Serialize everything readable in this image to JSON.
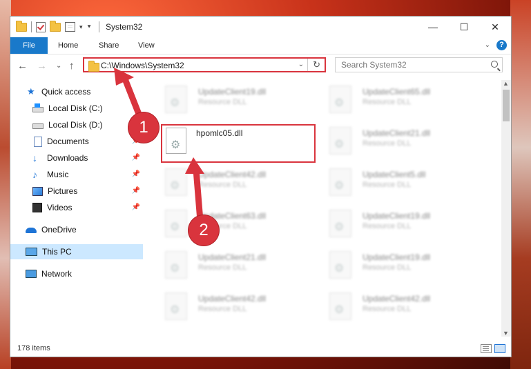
{
  "window": {
    "title": "System32",
    "controls": [
      "—",
      "☐",
      "✕"
    ]
  },
  "ribbon": {
    "tabs": [
      "File",
      "Home",
      "Share",
      "View"
    ]
  },
  "address": {
    "path": "C:\\Windows\\System32"
  },
  "search": {
    "placeholder": "Search System32"
  },
  "sidebar": {
    "items": [
      {
        "label": "Quick access",
        "icon": "star-icon"
      },
      {
        "label": "Local Disk (C:)",
        "icon": "windows-drive-icon"
      },
      {
        "label": "Local Disk (D:)",
        "icon": "drive-icon"
      },
      {
        "label": "Documents",
        "icon": "documents-icon",
        "pinned": true
      },
      {
        "label": "Downloads",
        "icon": "downloads-icon",
        "pinned": true
      },
      {
        "label": "Music",
        "icon": "music-icon",
        "pinned": true
      },
      {
        "label": "Pictures",
        "icon": "pictures-icon",
        "pinned": true
      },
      {
        "label": "Videos",
        "icon": "videos-icon",
        "pinned": true
      },
      {
        "label": "OneDrive",
        "icon": "onedrive-icon"
      },
      {
        "label": "This PC",
        "icon": "this-pc-icon",
        "selected": true
      },
      {
        "label": "Network",
        "icon": "network-icon"
      }
    ]
  },
  "files": {
    "highlighted": {
      "name": "hpomlc05.dll"
    },
    "blurred_type": "Resource DLL",
    "left_column": [
      "UpdateClient19.dll",
      "UpdateClient42.dll",
      "UpdateClient63.dll",
      "UpdateClient21.dll",
      "UpdateClient42.dll"
    ],
    "right_column": [
      "UpdateClient65.dll",
      "UpdateClient21.dll",
      "UpdateClient5.dll",
      "UpdateClient19.dll",
      "UpdateClient19.dll",
      "UpdateClient42.dll"
    ]
  },
  "status": {
    "item_count": "178 items"
  },
  "annotations": {
    "step1": "1",
    "step2": "2",
    "color": "#d9343d"
  }
}
